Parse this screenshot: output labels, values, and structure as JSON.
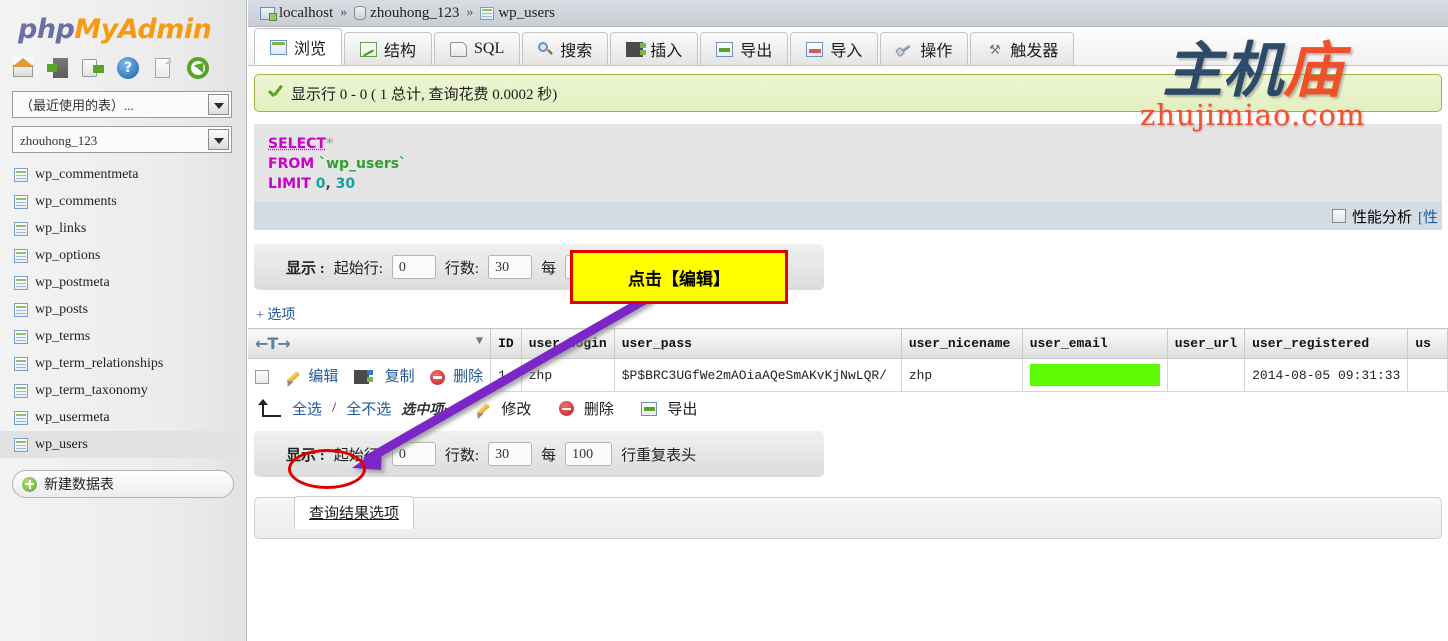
{
  "app": {
    "logo_php": "php",
    "logo_my": "My",
    "logo_admin": "Admin"
  },
  "sidebar": {
    "nav_icons": [
      "home-icon",
      "exit-icon",
      "external-link-icon",
      "help-icon",
      "documentation-icon",
      "refresh-icon"
    ],
    "recent_tables_select": "（最近使用的表）...",
    "database_select": "zhouhong_123",
    "tables": [
      "wp_commentmeta",
      "wp_comments",
      "wp_links",
      "wp_options",
      "wp_postmeta",
      "wp_posts",
      "wp_terms",
      "wp_term_relationships",
      "wp_term_taxonomy",
      "wp_usermeta",
      "wp_users"
    ],
    "active_table": "wp_users",
    "new_table_label": "新建数据表"
  },
  "breadcrumb": {
    "server": "localhost",
    "database": "zhouhong_123",
    "table": "wp_users",
    "separator": "»"
  },
  "tabs": [
    {
      "label": "浏览",
      "icon": "browse-icon",
      "active": true
    },
    {
      "label": "结构",
      "icon": "structure-icon",
      "active": false
    },
    {
      "label": "SQL",
      "icon": "sql-icon",
      "active": false
    },
    {
      "label": "搜索",
      "icon": "search-icon",
      "active": false
    },
    {
      "label": "插入",
      "icon": "insert-icon",
      "active": false
    },
    {
      "label": "导出",
      "icon": "export-icon",
      "active": false
    },
    {
      "label": "导入",
      "icon": "import-icon",
      "active": false
    },
    {
      "label": "操作",
      "icon": "operations-icon",
      "active": false
    },
    {
      "label": "触发器",
      "icon": "triggers-icon",
      "active": false
    }
  ],
  "status": {
    "message": "显示行 0 - 0 ( 1 总计, 查询花费 0.0002 秒)"
  },
  "sql": {
    "select": "SELECT",
    "star": "*",
    "from": "FROM",
    "table": "`wp_users`",
    "limit": "LIMIT",
    "limit_start": "0",
    "limit_comma": ",",
    "limit_count": "30"
  },
  "sql_footer": {
    "profiling_label": "性能分析",
    "edit_link": "[性"
  },
  "pagination": {
    "show_label": "显示 :",
    "start_row_label": "起始行:",
    "start_row_value": "0",
    "num_rows_label": "行数:",
    "num_rows_value": "30",
    "every_label": "每",
    "headers_every_value": "100",
    "repeat_headers_label": "行重复表头"
  },
  "options_link": "+ 选项",
  "results": {
    "sort_icon_label": "←T→",
    "columns": [
      "ID",
      "user_login",
      "user_pass",
      "user_nicename",
      "user_email",
      "user_url",
      "user_registered",
      "us"
    ],
    "row_actions": {
      "edit": "编辑",
      "copy": "复制",
      "delete": "删除"
    },
    "rows": [
      {
        "id": "1",
        "user_login": "zhp",
        "user_pass": "$P$BRC3UGfWe2mAOiaAQeSmAKvKjNwLQR/",
        "user_nicename": "zhp",
        "user_email": "",
        "user_url": "",
        "user_registered": "2014-08-05 09:31:33",
        "us": ""
      }
    ]
  },
  "bulk_actions": {
    "select_all": "全选",
    "slash": "/",
    "select_none": "全不选",
    "with_selected": "选中项:",
    "modify": "修改",
    "delete": "删除",
    "export": "导出"
  },
  "query_options": {
    "legend": "查询结果选项"
  },
  "annotations": {
    "callout_text": "点击【编辑】",
    "callout_bg": "#ffff00",
    "callout_border": "#e00000",
    "arrow_color": "#7b28c8",
    "highlight_circle_color": "#e00000"
  },
  "watermark": {
    "cn_dark": "主机",
    "cn_red": "庙",
    "url": "zhujimiao.com",
    "color_dark": "#1d3c5e",
    "color_red": "#f0441b"
  }
}
